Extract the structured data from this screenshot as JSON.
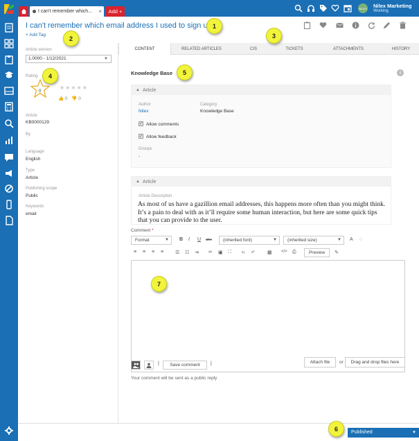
{
  "topbar": {
    "tab_title": "I can't remember which...",
    "tab_close": "×",
    "add_label": "Add +",
    "user_name": "Nilex Marketing",
    "user_status": "Working",
    "avatar_initials": "NILEX"
  },
  "article": {
    "title": "I can't remember which email address I used to sign up",
    "add_tag": "+ Add Tag"
  },
  "left": {
    "version_label": "Article version",
    "version_value": "1.0000 - 1/12/2021",
    "rating_label": "Rating",
    "rating_value": "0",
    "stars": "★★★★★",
    "likes": "0",
    "dislikes": "0",
    "article_label": "Article",
    "article_value": "KB0000129",
    "by_label": "By",
    "language_label": "Language",
    "language_value": "English",
    "type_label": "Type",
    "type_value": "Article",
    "scope_label": "Publishing scope",
    "scope_value": "Public",
    "keywords_label": "Keywords",
    "keywords_value": "email"
  },
  "tabs": [
    "CONTENT",
    "RELATED ARTICLES",
    "CIS",
    "TICKETS",
    "ATTACHMENTS",
    "HISTORY"
  ],
  "content": {
    "kb_title": "Knowledge Base",
    "section1_title": "Article",
    "author_label": "Author",
    "author_value": "Nilex",
    "category_label": "Category",
    "category_value": "Knowledge Base",
    "allow_comments": "Allow comments",
    "allow_feedback": "Allow feedback",
    "groups_label": "Groups",
    "groups_value": "-",
    "section2_title": "Article",
    "desc_label": "Article Description",
    "description": "As most of us have a gazillion email addresses, this happens more often than you might think. It’s a pain to deal with as it’ll require some human interaction, but here are some quick tips that you can provide to the user."
  },
  "comment": {
    "label": "Comment",
    "required_mark": "*",
    "format_label": "Format",
    "font_label": "(inherited font)",
    "size_label": "(inherited size)",
    "bold": "B",
    "italic": "I",
    "underline": "U",
    "strike": "abc",
    "preview_label": "Preview",
    "save_label": "Save comment",
    "sep": "|",
    "attach_label": "Attach file",
    "or_label": "or",
    "drop_label": "Drag and drop files here",
    "public_note": "Your comment will be sent as a public reply"
  },
  "status": {
    "value": "Published"
  },
  "callouts": [
    "1",
    "2",
    "3",
    "4",
    "5",
    "6",
    "7"
  ],
  "colors": {
    "primary": "#1a6fb5",
    "accent": "#d9232d",
    "callout": "#f1f43a"
  }
}
